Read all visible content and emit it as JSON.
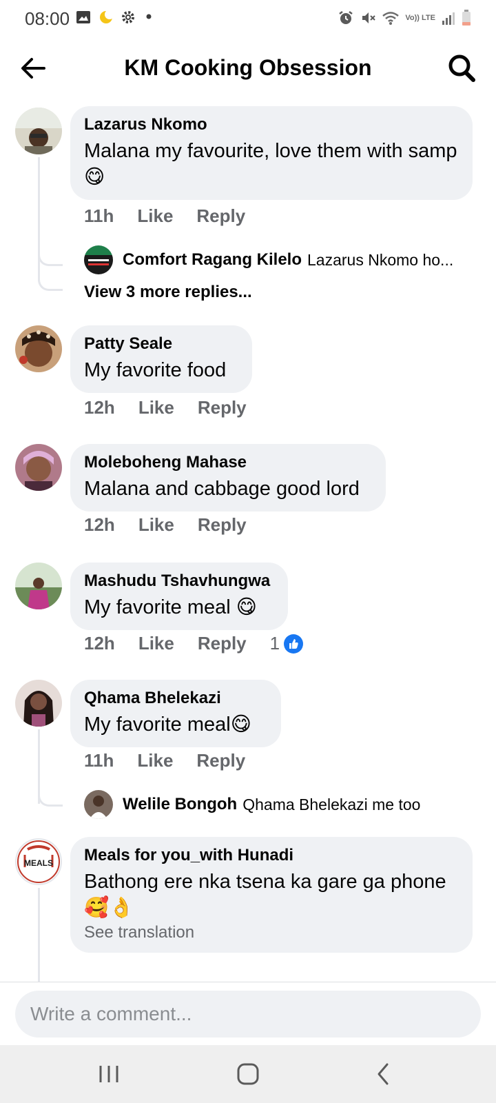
{
  "status_bar": {
    "time": "08:00",
    "network": "Vo)) LTE",
    "left_icons": [
      "image-icon",
      "moon-icon",
      "gear-icon",
      "dot-icon"
    ],
    "right_icons": [
      "alarm-icon",
      "mute-icon",
      "wifi-icon",
      "signal-icon",
      "battery-icon"
    ]
  },
  "header": {
    "title": "KM Cooking Obsession",
    "back_icon": "arrow-left-icon",
    "search_icon": "search-icon"
  },
  "comments": [
    {
      "author": "Lazarus Nkomo",
      "text": "Malana  my favourite, love them with samp😋",
      "time": "11h",
      "like": "Like",
      "reply": "Reply",
      "replies": [
        {
          "author": "Comfort Ragang Kilelo",
          "text": "Lazarus Nkomo ho..."
        }
      ],
      "view_more": "View 3 more replies..."
    },
    {
      "author": "Patty Seale",
      "text": "My favorite food",
      "time": "12h",
      "like": "Like",
      "reply": "Reply"
    },
    {
      "author": "Moleboheng Mahase",
      "text": "Malana and cabbage good lord",
      "time": "12h",
      "like": "Like",
      "reply": "Reply"
    },
    {
      "author": "Mashudu Tshavhungwa",
      "text": "My favorite meal 😋",
      "time": "12h",
      "like": "Like",
      "reply": "Reply",
      "reaction_count": "1"
    },
    {
      "author": "Qhama Bhelekazi",
      "text": "My favorite meal😋",
      "time": "11h",
      "like": "Like",
      "reply": "Reply",
      "replies": [
        {
          "author": "Welile Bongoh",
          "text": "Qhama Bhelekazi me too"
        }
      ]
    },
    {
      "author": "Meals for you_with Hunadi",
      "text": "Bathong ere nka tsena ka gare ga phone 🥰👌",
      "see_translation": "See translation",
      "avatar_text": "MEALS"
    }
  ],
  "composer": {
    "placeholder": "Write a comment..."
  },
  "navbar": {
    "buttons": [
      "recent-apps-icon",
      "home-icon",
      "back-nav-icon"
    ]
  },
  "colors": {
    "bubble": "#eff1f4",
    "secondary_text": "#65676b",
    "like_blue": "#1877f2"
  }
}
